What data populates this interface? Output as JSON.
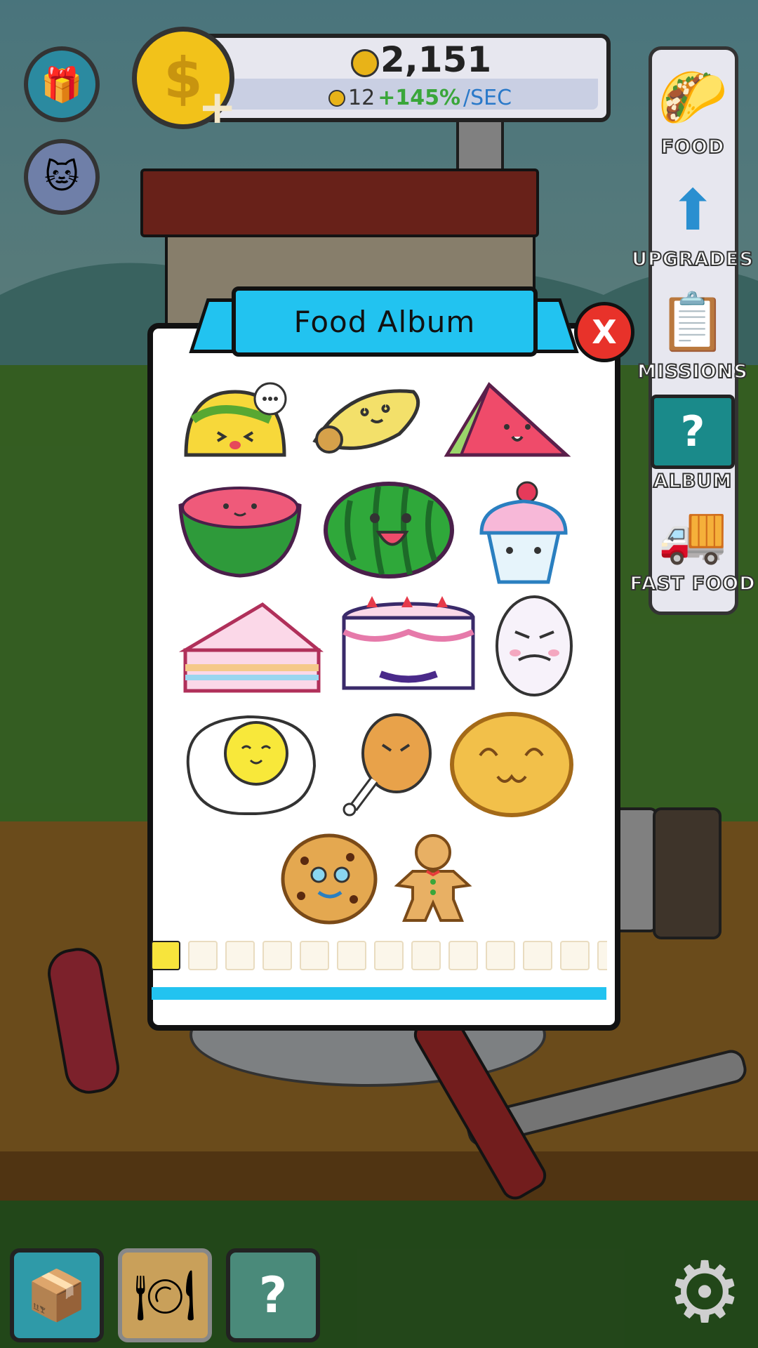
{
  "header": {
    "coins_total": "2,151",
    "rate_base": "12",
    "rate_bonus": "+145%",
    "rate_unit": "/SEC"
  },
  "left_buttons": [
    {
      "name": "gift",
      "icon": "gift-icon"
    },
    {
      "name": "cat",
      "icon": "cat-icon"
    }
  ],
  "sidebar": {
    "items": [
      {
        "label": "FOOD",
        "icon": "taco-icon"
      },
      {
        "label": "UPGRADES",
        "icon": "upgrade-arrow-icon"
      },
      {
        "label": "MISSIONS",
        "icon": "clipboard-icon"
      },
      {
        "label": "ALBUM",
        "icon": "album-book-icon"
      },
      {
        "label": "FAST FOOD",
        "icon": "food-truck-icon"
      }
    ]
  },
  "modal": {
    "title": "Food Album",
    "close_label": "X",
    "foods": [
      "taco",
      "burrito",
      "watermelon-slice",
      "watermelon-half",
      "watermelon",
      "cupcake",
      "cake-slice",
      "cake",
      "meme-egg",
      "fried-egg",
      "chicken-drumstick",
      "pancake",
      "cookie",
      "gingerbread-man"
    ],
    "thumbnail_count": 13,
    "active_thumbnail": 0
  },
  "bottom_bar": [
    {
      "name": "crates",
      "icon": "crates-icon"
    },
    {
      "name": "table",
      "icon": "plate-table-icon"
    },
    {
      "name": "mystery",
      "icon": "question-icon"
    }
  ],
  "colors": {
    "accent": "#22c3f0",
    "close": "#e8322a",
    "coin": "#f2c21a",
    "bonus_green": "#3aa63a",
    "sec_blue": "#2a79c9"
  }
}
